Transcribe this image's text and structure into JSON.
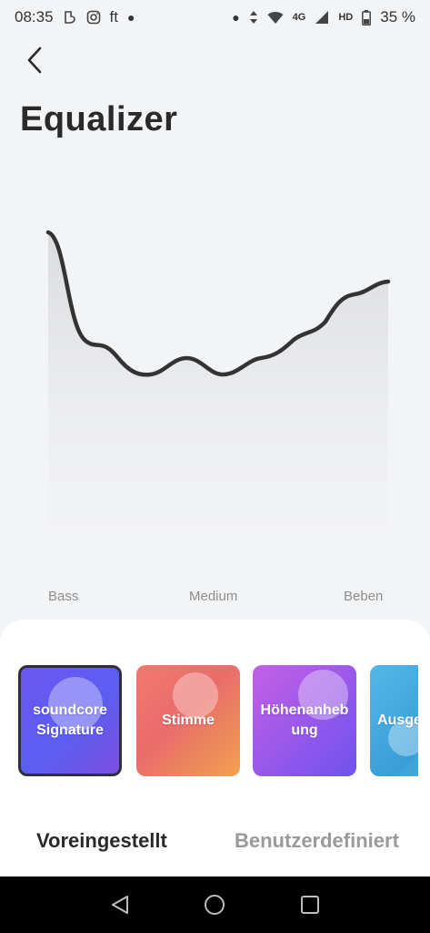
{
  "status_bar": {
    "time": "08:35",
    "battery": "35 %",
    "network": "4G",
    "hd": "HD",
    "icons_left": [
      "notification-icon",
      "instagram-icon",
      "ft-icon"
    ],
    "ft_text": "ft",
    "icons_right": [
      "data-arrows-icon",
      "wifi-icon",
      "signal-icon",
      "battery-icon"
    ]
  },
  "header": {
    "back_icon": "chevron-left-icon",
    "title": "Equalizer"
  },
  "eq": {
    "labels": {
      "bass": "Bass",
      "medium": "Medium",
      "beben": "Beben"
    },
    "line_color": "#333333",
    "fill_color": "#dedfe1"
  },
  "presets": [
    {
      "label": "soundcore Signature",
      "selected": true
    },
    {
      "label": "Stimme",
      "selected": false
    },
    {
      "label": "Höhenanheb ung",
      "selected": false
    },
    {
      "label": "Ausge",
      "selected": false
    }
  ],
  "tabs": {
    "preset": "Voreingestellt",
    "custom": "Benutzerdefiniert",
    "active": "preset"
  },
  "nav": {
    "back": "triangle-back-icon",
    "home": "circle-home-icon",
    "recents": "square-recents-icon"
  },
  "colors": {
    "background": "#f3f4f6",
    "sheet": "#ffffff",
    "selected_border": "#2e2e3c",
    "text_active": "#2a2a2a",
    "text_inactive": "#9a9a9a"
  }
}
